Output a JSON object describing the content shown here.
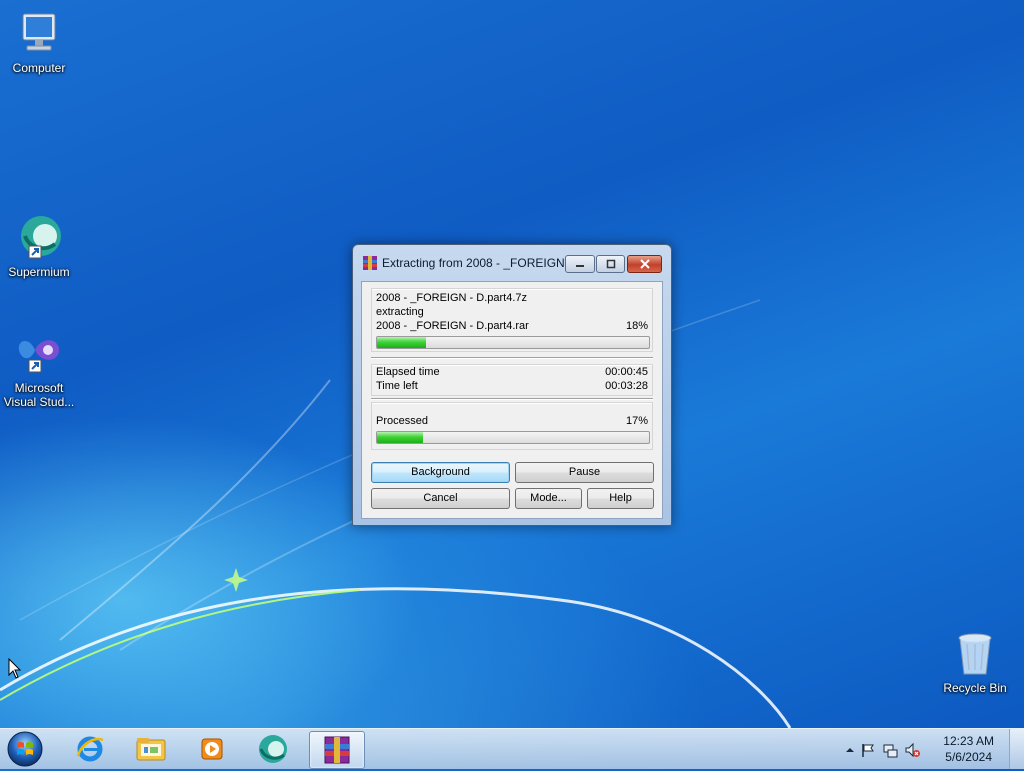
{
  "desktop": {
    "icons": [
      {
        "label": "Computer"
      },
      {
        "label": "Supermium"
      },
      {
        "label": "Microsoft Visual Stud..."
      },
      {
        "label": "Recycle Bin"
      }
    ]
  },
  "dialog": {
    "title": "Extracting from 2008 - _FOREIGN...",
    "archive_name": "2008 - _FOREIGN - D.part4.7z",
    "action": "extracting",
    "current_file": "2008 - _FOREIGN - D.part4.rar",
    "file_percent_text": "18%",
    "file_progress": 0.18,
    "elapsed_label": "Elapsed time",
    "elapsed_value": "00:00:45",
    "timeleft_label": "Time left",
    "timeleft_value": "00:03:28",
    "processed_label": "Processed",
    "processed_percent_text": "17%",
    "processed_progress": 0.17,
    "buttons": {
      "background": "Background",
      "pause": "Pause",
      "cancel": "Cancel",
      "mode": "Mode...",
      "help": "Help"
    }
  },
  "taskbar": {
    "items": [
      "internet-explorer-icon",
      "file-explorer-icon",
      "media-player-icon",
      "supermium-icon",
      "winrar-icon"
    ],
    "clock": {
      "time": "12:23 AM",
      "date": "5/6/2024"
    }
  },
  "colors": {
    "desktop_blue": "#0f5cc4",
    "progress_green": "#3ed337"
  }
}
